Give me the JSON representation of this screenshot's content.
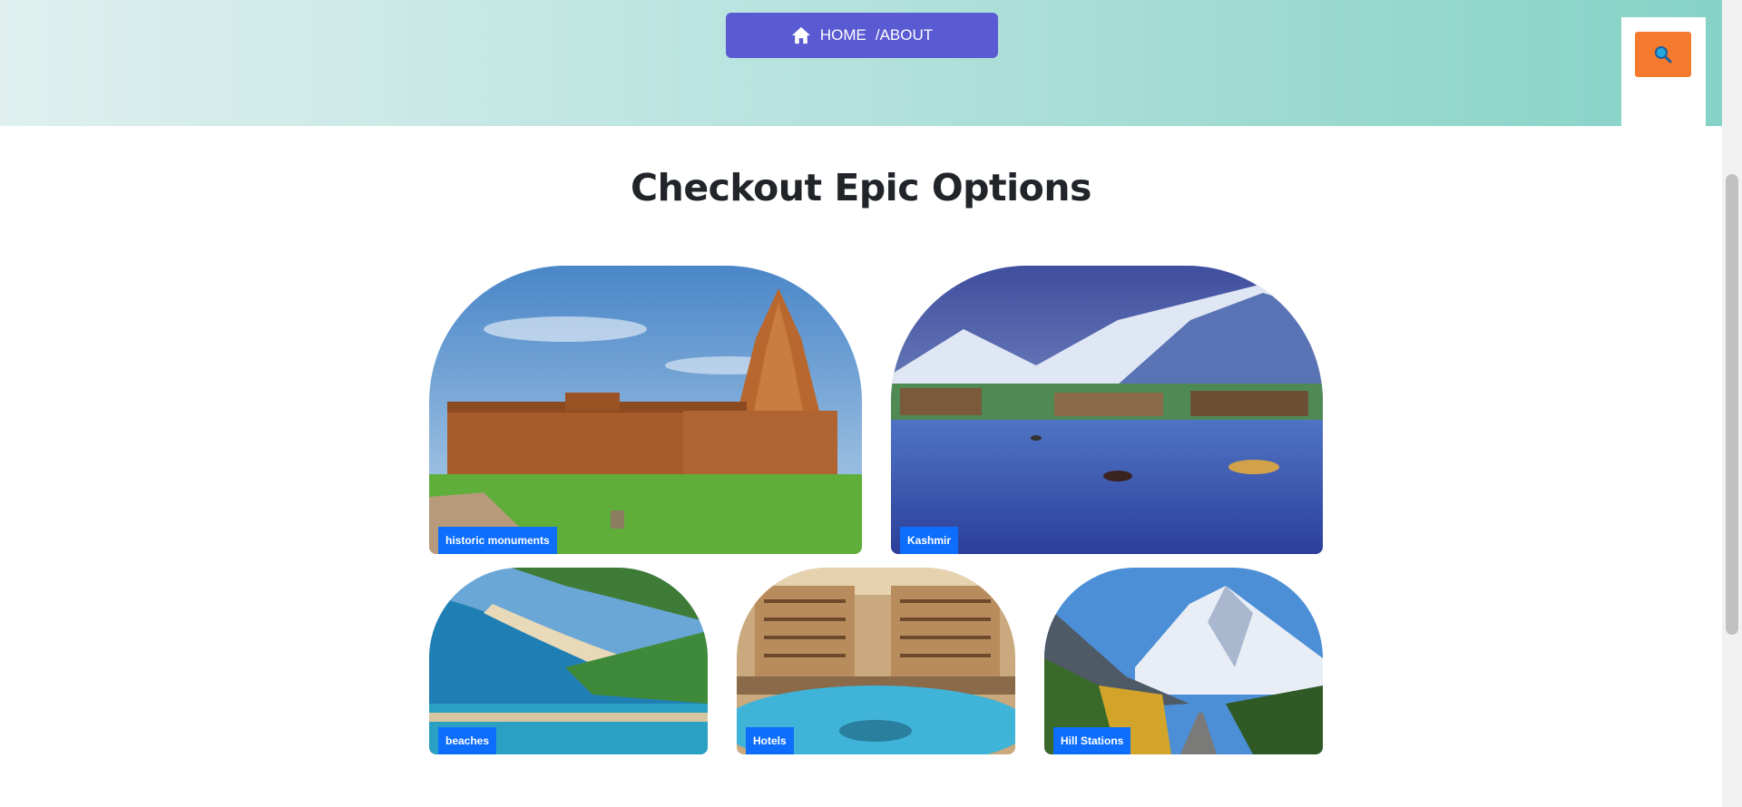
{
  "header": {
    "breadcrumb": {
      "home": "HOME",
      "current": "/ABOUT"
    }
  },
  "section": {
    "title": "Checkout Epic Options"
  },
  "cards": [
    {
      "label": "historic monuments"
    },
    {
      "label": "Kashmir"
    },
    {
      "label": "beaches"
    },
    {
      "label": "Hotels"
    },
    {
      "label": "Hill Stations"
    }
  ],
  "icons": {
    "home": "home-icon",
    "search": "search-icon"
  },
  "colors": {
    "breadcrumb_bg": "#5a5ad3",
    "search_button": "#f47a2e",
    "tag_bg": "#0d6efd",
    "hero_gradient_start": "#dff0ef",
    "hero_gradient_end": "#86d2c6"
  }
}
